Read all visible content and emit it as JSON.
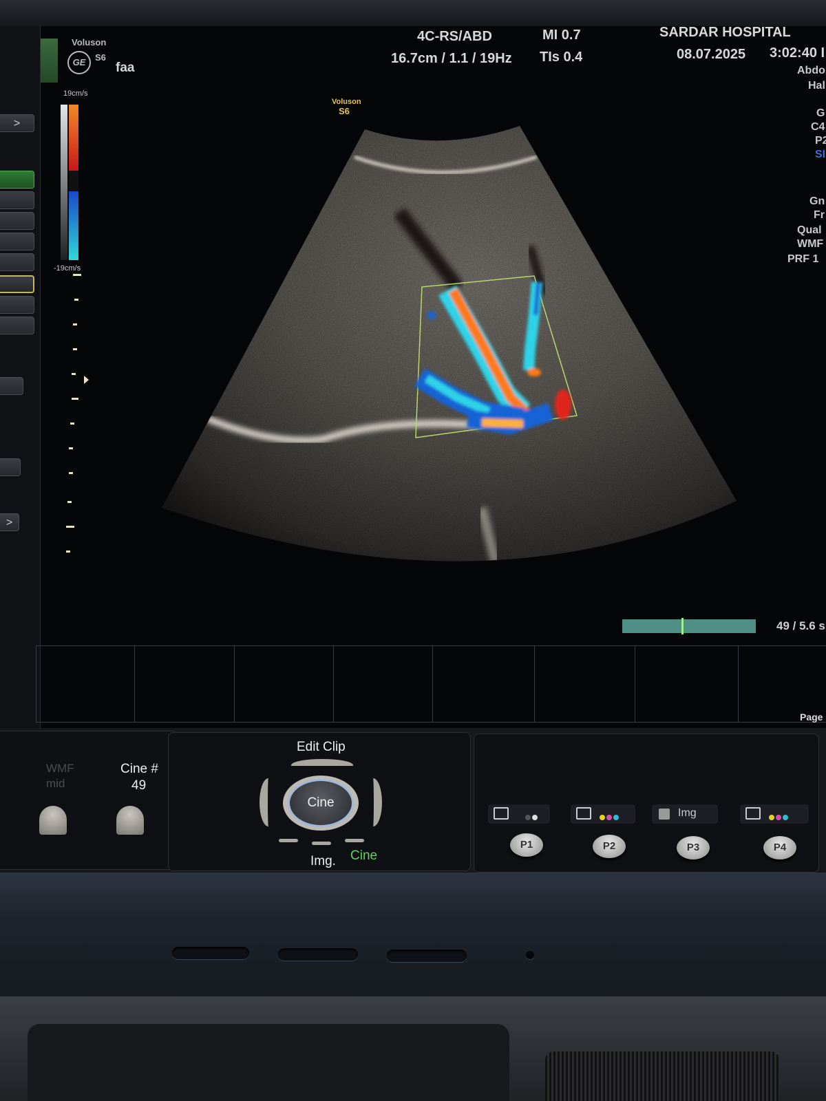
{
  "header": {
    "brand": "Voluson",
    "model": "S6",
    "operator": "faa",
    "probe_preset": "4C-RS/ABD",
    "depth_info": "16.7cm / 1.1 / 19Hz",
    "mi": "MI 0.7",
    "tis": "TIs 0.4",
    "hospital": "SARDAR HOSPITAL",
    "date": "08.07.2025",
    "time": "3:02:40 I"
  },
  "image_label": {
    "brand": "Voluson",
    "model": "S6"
  },
  "color_scale": {
    "top": "19cm/s",
    "bottom": "-19cm/s"
  },
  "right_params": [
    "Abdo",
    "Hal",
    "G",
    "C4",
    "P2",
    "SI",
    "Gn",
    "Fr",
    "Qual",
    "WMF",
    "PRF 1"
  ],
  "left_menu": {
    "arrow_top": ">",
    "arrow_bottom": ">"
  },
  "cine_bar": {
    "counter": "49 / 5.6 s",
    "page": "Page"
  },
  "control_panel": {
    "wmf_label": "WMF",
    "wmf_sub": "mid",
    "cine_num_label": "Cine #",
    "cine_num_value": "49",
    "edit_clip": "Edit Clip",
    "cine_button": "Cine",
    "img_label": "Img.",
    "cine_label": "Cine",
    "p3_slot_label": "Img",
    "presets": [
      "P1",
      "P2",
      "P3",
      "P4"
    ]
  },
  "colors": {
    "doppler_red": "#e0261c",
    "doppler_orange": "#ff7a12",
    "doppler_blue": "#1563d6",
    "doppler_cyan": "#2fd3e8",
    "roi_box": "#b8d86a",
    "cine_text_green": "#5fd45a",
    "brand_yellow": "#e8c84a"
  }
}
